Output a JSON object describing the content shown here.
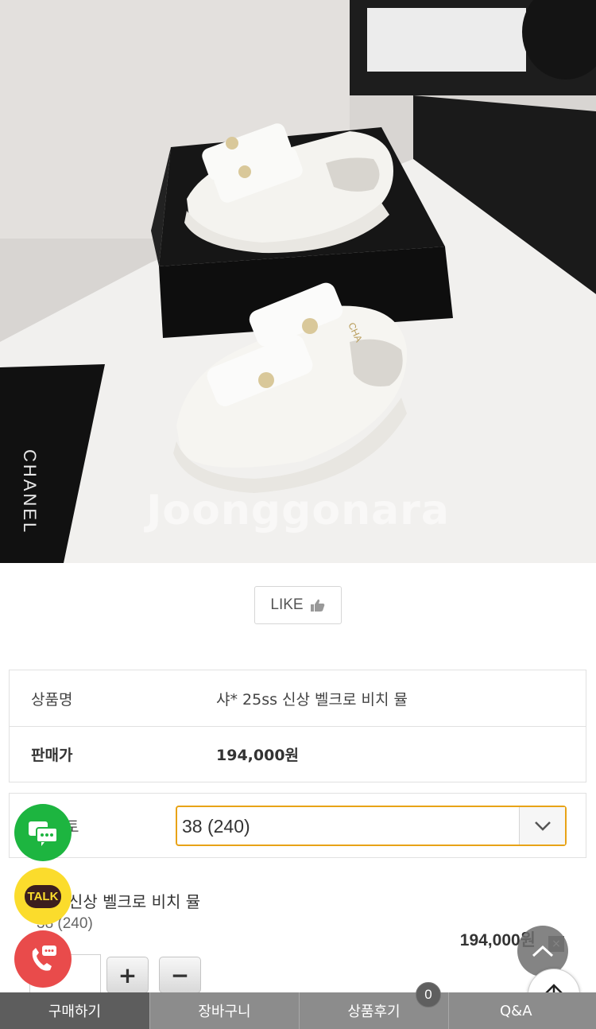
{
  "photo": {
    "watermark": "Joonggonara",
    "box_brand": "CHANEL",
    "box_brand_side": "CHA"
  },
  "like": {
    "label": "LIKE"
  },
  "info": {
    "name_label": "상품명",
    "name_value": "샤* 25ss 신상 벨크로 비치 뮬",
    "price_label": "판매가",
    "price_value": "194,000원"
  },
  "option": {
    "label_partial": "토",
    "selected": "38 (240)"
  },
  "selected_item": {
    "name": "5ss 신상 벨크로 비치 뮬",
    "option": "38 (240)",
    "price": "194,000원",
    "plus": "+",
    "minus": "−",
    "remove": "×"
  },
  "floating": {
    "talk_label": "TALK"
  },
  "tabs": [
    {
      "label": "구매하기"
    },
    {
      "label": "장바구니"
    },
    {
      "label": "상품후기",
      "badge": "0"
    },
    {
      "label": "Q&A"
    }
  ],
  "colors": {
    "select_border": "#e8a317",
    "chat_green": "#1db540",
    "talk_yellow": "#fbdc2c",
    "call_red": "#e94b4b",
    "tab_active": "#5d5d5d",
    "tab_default": "#8c8c8c"
  }
}
